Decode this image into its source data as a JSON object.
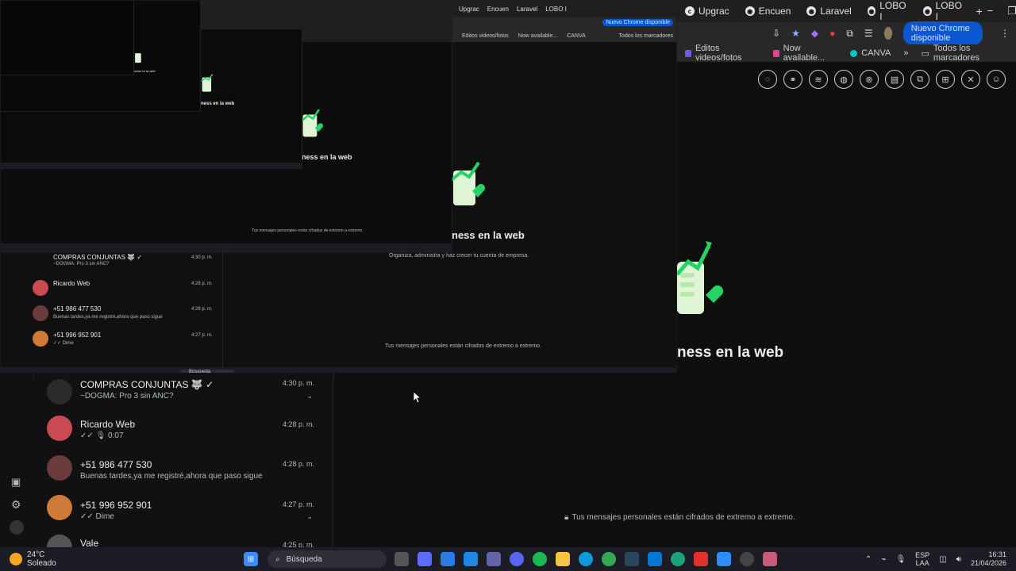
{
  "chrome": {
    "tabs": [
      {
        "label": "Upgrac",
        "icon": "dark-c"
      },
      {
        "label": "Encuen",
        "icon": "globe"
      },
      {
        "label": "Laravel",
        "icon": "globe"
      },
      {
        "label": "LOBO I",
        "icon": "globe"
      },
      {
        "label": "LOBO I",
        "icon": "globe"
      }
    ],
    "new_tab": "+",
    "win": {
      "min": "−",
      "max": "❐",
      "close": "✕"
    },
    "new_chrome_label": "Nuevo Chrome disponible",
    "bookmarks": [
      {
        "label": "Editos videos/fotos",
        "color": "#6c5ce7"
      },
      {
        "label": "Now available...",
        "color": "#e84393"
      },
      {
        "label": "CANVA",
        "color": "#00c4cc"
      }
    ],
    "bookmarks_more": "»",
    "all_bookmarks": "Todos los marcadores"
  },
  "wa_business": {
    "promo_title": "ness en la web",
    "promo_text": "Organiza, administra y haz crecer tu cuenta de empresa.",
    "encrypted_text": "Tus mensajes personales están cifrados de extremo a extremo."
  },
  "chats": [
    {
      "name": "COMPRAS CONJUNTAS 🐺 ✓",
      "message": "~DOGMA: Pro 3 sin ANC?",
      "time": "4:30 p. m.",
      "avatar_color": "#2b2b2b",
      "chev": "⌄"
    },
    {
      "name": "Ricardo Web",
      "message": "✓✓ 🎙 0:07",
      "time": "4:28 p. m.",
      "avatar_color": "#c94a52",
      "chev": ""
    },
    {
      "name": "+51 986 477 530",
      "message": "Buenas tardes,ya me registré,ahora que paso sigue",
      "time": "4:28 p. m.",
      "avatar_color": "#6b3b3b",
      "chev": ""
    },
    {
      "name": "+51 996 952 901",
      "message": "✓✓ Dime",
      "time": "4:27 p. m.",
      "avatar_color": "#d07a3a",
      "chev": "⌄"
    },
    {
      "name": "Vale",
      "message": "",
      "time": "4:25 p. m.",
      "avatar_color": "#555",
      "chev": ""
    }
  ],
  "taskbar": {
    "weather_temp": "24°C",
    "weather_desc": "Soleado",
    "search_placeholder": "Búsqueda",
    "lang": "ESP",
    "lang_sub": "LAA",
    "time": "16:31",
    "date": "21/04/2026"
  }
}
